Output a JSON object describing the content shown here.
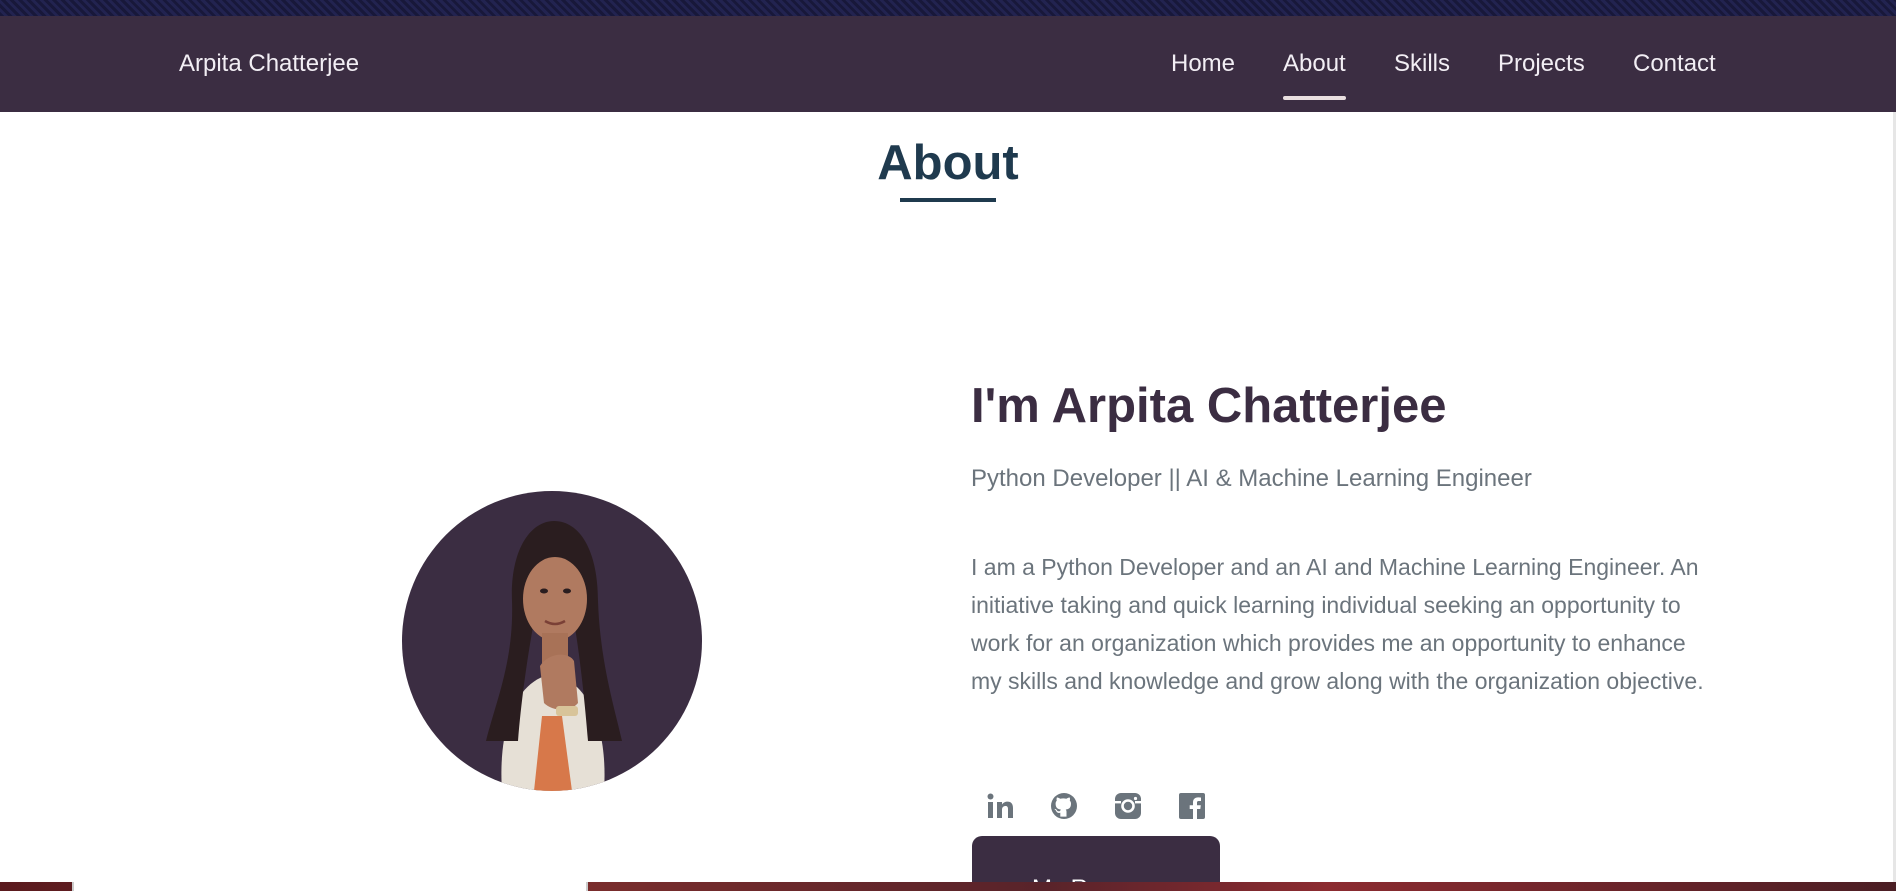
{
  "nav": {
    "brand": "Arpita Chatterjee",
    "links": [
      {
        "label": "Home",
        "active": false
      },
      {
        "label": "About",
        "active": true
      },
      {
        "label": "Skills",
        "active": false
      },
      {
        "label": "Projects",
        "active": false
      },
      {
        "label": "Contact",
        "active": false
      }
    ]
  },
  "about": {
    "section_title": "About",
    "heading": "I'm Arpita Chatterjee",
    "role": "Python Developer || AI & Machine Learning Engineer",
    "bio": "I am a Python Developer and an AI and Machine Learning Engineer. An initiative taking and quick learning individual seeking an opportunity to work for an organization which provides me an opportunity to enhance my skills and knowledge and grow along with the organization objective.",
    "socials": [
      "linkedin-icon",
      "github-icon",
      "instagram-icon",
      "facebook-icon"
    ],
    "resume_label": "My Resume"
  },
  "colors": {
    "nav_bg": "#3b2d42",
    "accent": "#3b2d42",
    "title": "#1f3a4e",
    "body_text": "#6b747c"
  }
}
